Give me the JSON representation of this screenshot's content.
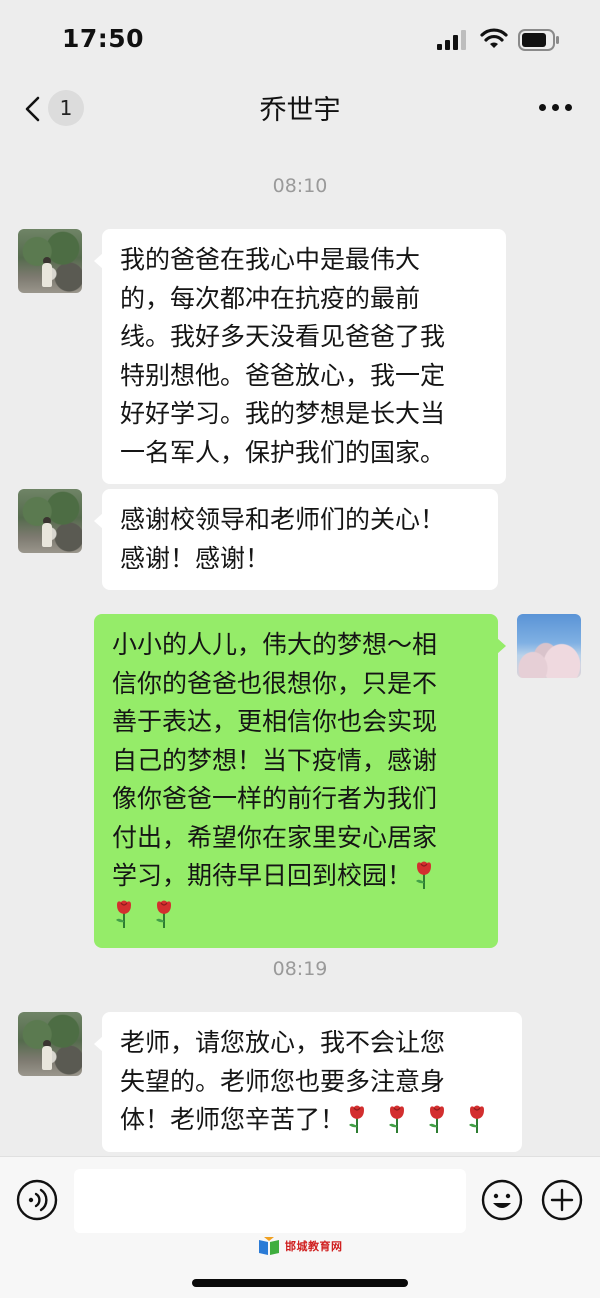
{
  "status_bar": {
    "time": "17:50"
  },
  "nav": {
    "unread_count": "1",
    "title": "乔世宇"
  },
  "chat": {
    "timestamp_1": "08:10",
    "timestamp_2": "08:19",
    "messages": [
      {
        "sender": "contact",
        "text": "我的爸爸在我心中是最伟大\n的，每次都冲在抗疫的最前\n线。我好多天没看见爸爸了我\n特别想他。爸爸放心，我一定\n好好学习。我的梦想是长大当\n一名军人，保护我们的国家。"
      },
      {
        "sender": "contact",
        "text": "感谢校领导和老师们的关心！\n感谢！感谢！"
      },
      {
        "sender": "me",
        "text": "小小的人儿，伟大的梦想～相\n信你的爸爸也很想你，只是不\n善于表达，更相信你也会实现\n自己的梦想！当下疫情，感谢\n像你爸爸一样的前行者为我们\n付出，希望你在家里安心居家\n学习，期待早日回到校园！"
      },
      {
        "sender": "contact",
        "text": "老师，请您放心，我不会让您\n失望的。老师您也要多注意身\n体！老师您辛苦了！"
      }
    ]
  },
  "icons": {
    "emoji": "rose-icon",
    "message_3_trailing_roses": 3,
    "message_4_trailing_roses": 4
  },
  "input_bar": {
    "placeholder": ""
  },
  "watermark": {
    "text": "邯城教育网"
  },
  "colors": {
    "background": "#ededed",
    "incoming_bubble": "#ffffff",
    "outgoing_bubble": "#95ec69"
  }
}
